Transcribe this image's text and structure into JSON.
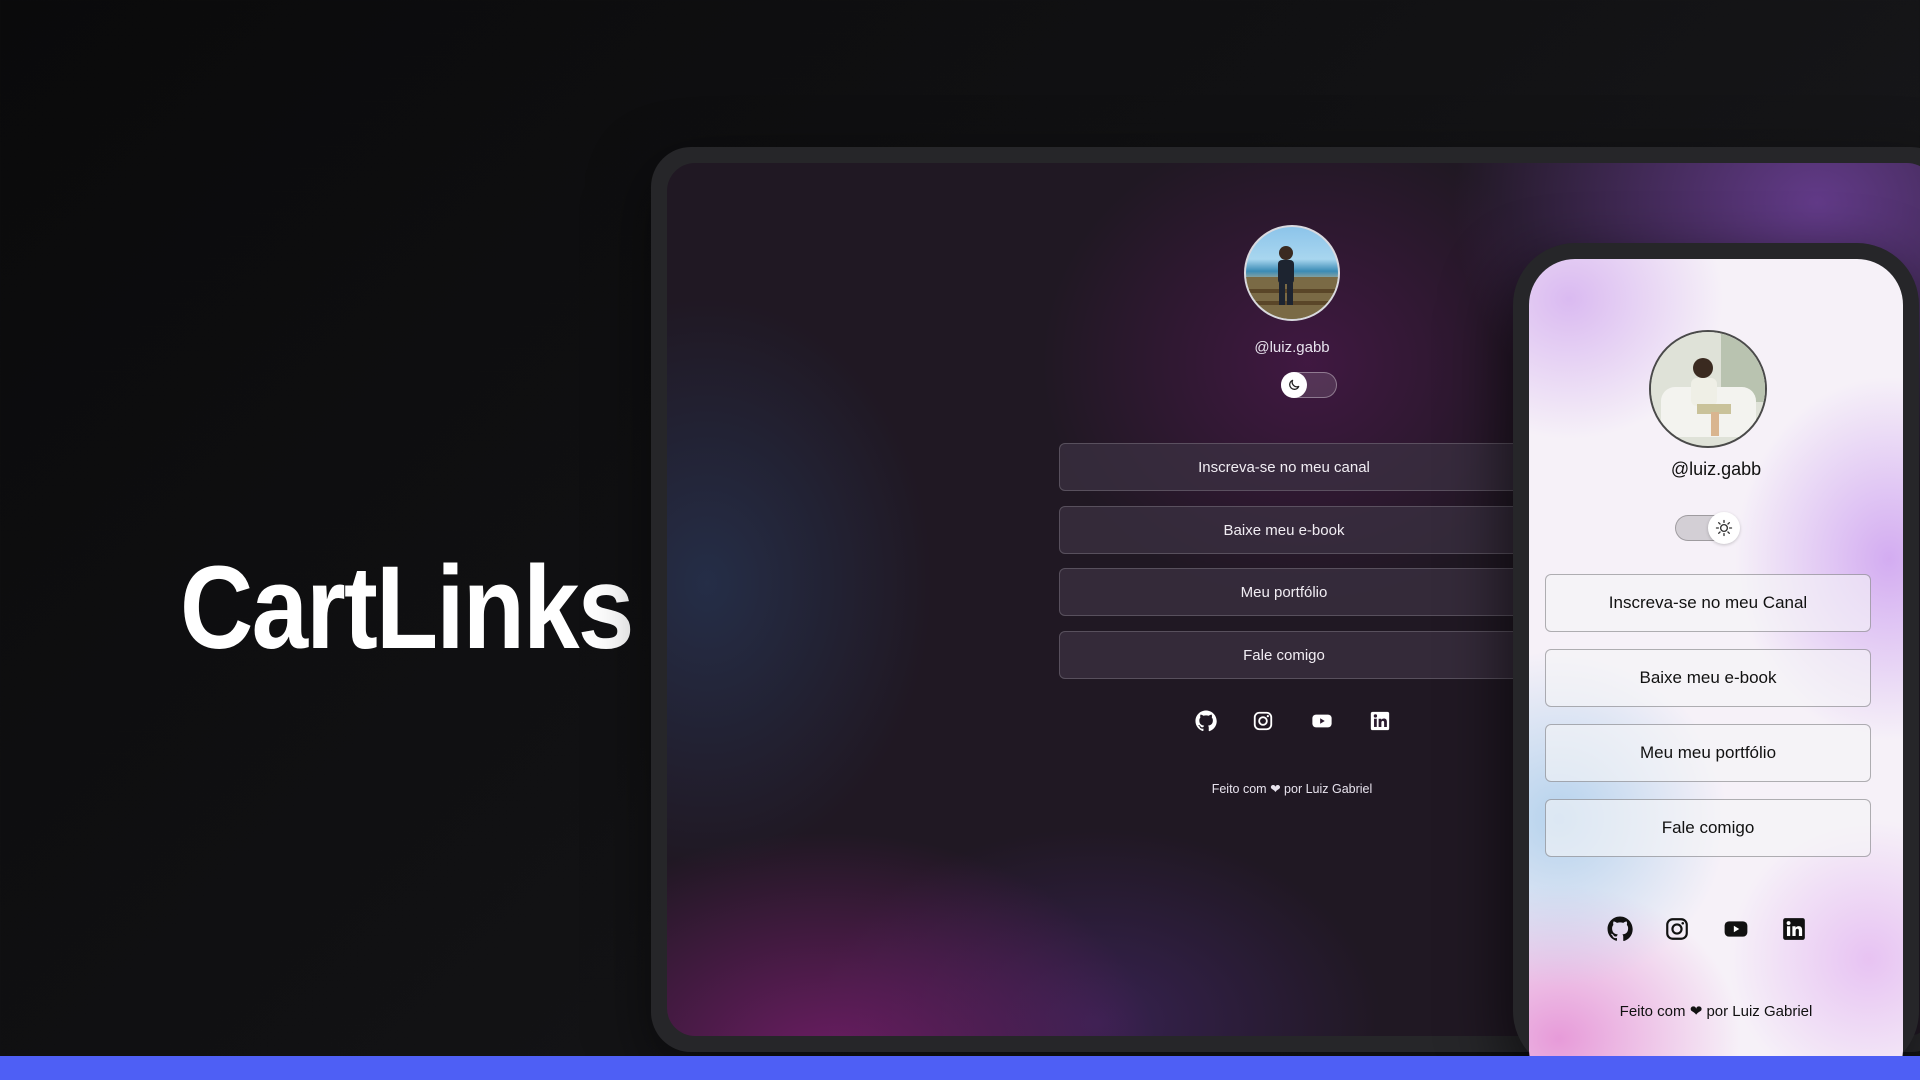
{
  "brand": {
    "title": "CartLinks"
  },
  "colors": {
    "accent_bar": "#4e5ff5",
    "background": "#0f0f11"
  },
  "desktop": {
    "handle": "@luiz.gabb",
    "theme_toggle": {
      "state": "dark",
      "icon": "moon-icon"
    },
    "links": [
      "Inscreva-se no meu canal",
      "Baixe meu e-book",
      "Meu portfólio",
      "Fale comigo"
    ],
    "social_icons": [
      "github-icon",
      "instagram-icon",
      "youtube-icon",
      "linkedin-icon"
    ],
    "footer": {
      "prefix": "Feito com",
      "heart": "❤",
      "suffix": "por Luiz Gabriel"
    }
  },
  "mobile": {
    "handle": "@luiz.gabb",
    "theme_toggle": {
      "state": "light",
      "icon": "sun-icon"
    },
    "links": [
      "Inscreva-se no meu Canal",
      "Baixe meu e-book",
      "Meu meu portfólio",
      "Fale comigo"
    ],
    "social_icons": [
      "github-icon",
      "instagram-icon",
      "youtube-icon",
      "linkedin-icon"
    ],
    "footer": {
      "prefix": "Feito com",
      "heart": "❤",
      "suffix": "por Luiz Gabriel"
    }
  }
}
